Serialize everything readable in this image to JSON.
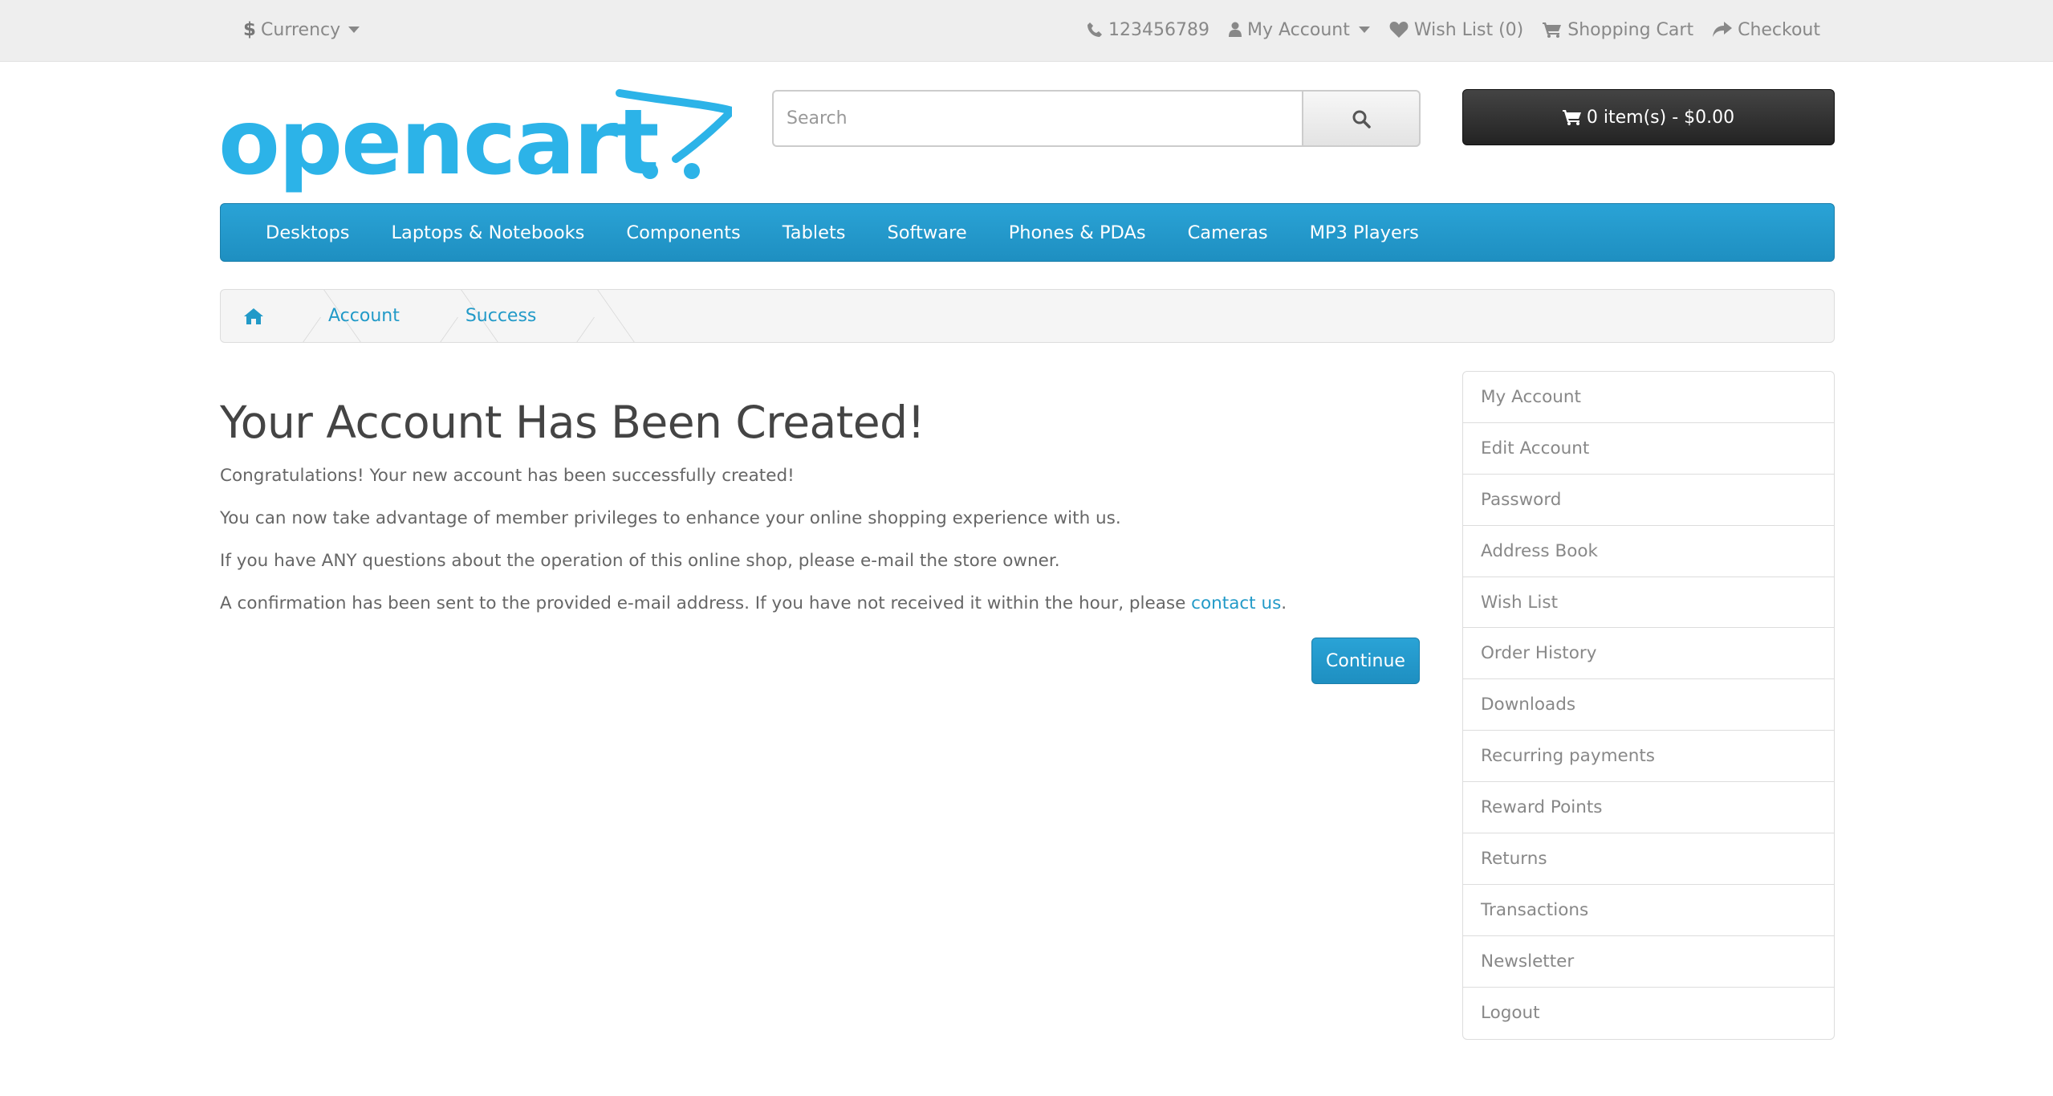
{
  "topbar": {
    "currency_symbol": "$",
    "currency_label": "Currency",
    "phone": "123456789",
    "my_account": "My Account",
    "wishlist": "Wish List (0)",
    "shopping_cart": "Shopping Cart",
    "checkout": "Checkout"
  },
  "header": {
    "logo_text": "opencart",
    "search_placeholder": "Search",
    "cart_label": "0 item(s) - $0.00"
  },
  "menu": [
    "Desktops",
    "Laptops & Notebooks",
    "Components",
    "Tablets",
    "Software",
    "Phones & PDAs",
    "Cameras",
    "MP3 Players"
  ],
  "breadcrumb": [
    "Account",
    "Success"
  ],
  "main": {
    "title": "Your Account Has Been Created!",
    "p1": "Congratulations! Your new account has been successfully created!",
    "p2": "You can now take advantage of member privileges to enhance your online shopping experience with us.",
    "p3": "If you have ANY questions about the operation of this online shop, please e-mail the store owner.",
    "p4_before": "A confirmation has been sent to the provided e-mail address. If you have not received it within the hour, please ",
    "p4_link": "contact us",
    "p4_after": ".",
    "continue_label": "Continue"
  },
  "sidebar": [
    "My Account",
    "Edit Account",
    "Password",
    "Address Book",
    "Wish List",
    "Order History",
    "Downloads",
    "Recurring payments",
    "Reward Points",
    "Returns",
    "Transactions",
    "Newsletter",
    "Logout"
  ],
  "colors": {
    "accent": "#229ac8",
    "menu_bg": "#229ac8",
    "cart_bg": "#363636",
    "topbar_bg": "#eeeeee"
  }
}
